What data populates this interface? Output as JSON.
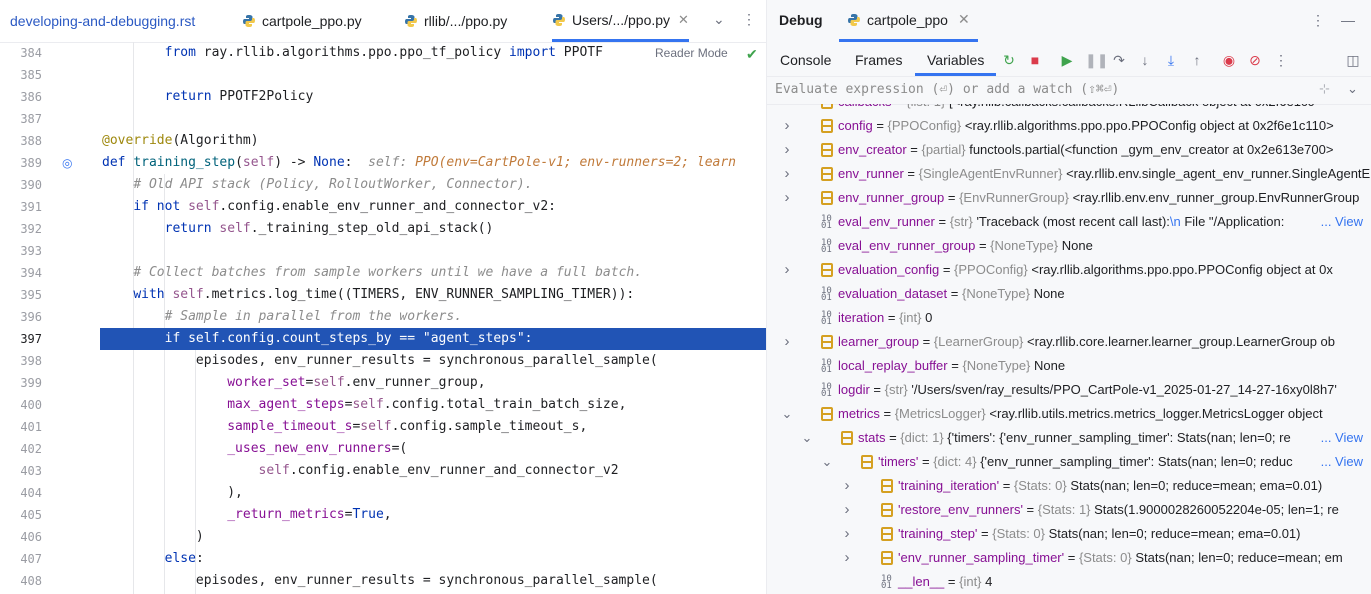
{
  "editor": {
    "tabs": [
      {
        "label": "developing-and-debugging.rst",
        "python": false
      },
      {
        "label": "cartpole_ppo.py",
        "python": true
      },
      {
        "label": "rllib/.../ppo.py",
        "python": true
      },
      {
        "label": "Users/.../ppo.py",
        "python": true,
        "active": true,
        "closable": true
      }
    ],
    "reader_mode": "Reader Mode",
    "current_line": 397,
    "line_numbers": [
      384,
      385,
      386,
      387,
      388,
      389,
      390,
      391,
      392,
      393,
      394,
      395,
      396,
      397,
      398,
      399,
      400,
      401,
      402,
      403,
      404,
      405,
      406,
      407,
      408
    ],
    "lines": [
      [
        {
          "t": "        "
        },
        {
          "t": "from",
          "c": "kw"
        },
        {
          "t": " ray.rllib.algorithms.ppo.ppo_tf_policy "
        },
        {
          "t": "import",
          "c": "kw"
        },
        {
          "t": " PPOTF"
        }
      ],
      [],
      [
        {
          "t": "        "
        },
        {
          "t": "return",
          "c": "kw"
        },
        {
          "t": " PPOTF2Policy"
        }
      ],
      [],
      [
        {
          "t": "@override",
          "c": "dec"
        },
        {
          "t": "(Algorithm)"
        }
      ],
      [
        {
          "t": "def",
          "c": "kw"
        },
        {
          "t": " "
        },
        {
          "t": "training_step",
          "c": "fn"
        },
        {
          "t": "("
        },
        {
          "t": "self",
          "c": "self"
        },
        {
          "t": ") -> "
        },
        {
          "t": "None",
          "c": "kw"
        },
        {
          "t": ":  "
        },
        {
          "t": "self: ",
          "c": "hintlbl"
        },
        {
          "t": "PPO(env=CartPole-v1; env-runners=2; learn",
          "c": "hint"
        }
      ],
      [
        {
          "t": "    "
        },
        {
          "t": "# Old API stack (Policy, RolloutWorker, Connector).",
          "c": "cm"
        }
      ],
      [
        {
          "t": "    "
        },
        {
          "t": "if not",
          "c": "kw"
        },
        {
          "t": " "
        },
        {
          "t": "self",
          "c": "self"
        },
        {
          "t": ".config.enable_env_runner_and_connector_v2:"
        }
      ],
      [
        {
          "t": "        "
        },
        {
          "t": "return",
          "c": "kw"
        },
        {
          "t": " "
        },
        {
          "t": "self",
          "c": "self"
        },
        {
          "t": "._training_step_old_api_stack()"
        }
      ],
      [],
      [
        {
          "t": "    "
        },
        {
          "t": "# Collect batches from sample workers until we have a full batch.",
          "c": "cm"
        }
      ],
      [
        {
          "t": "    "
        },
        {
          "t": "with",
          "c": "kw"
        },
        {
          "t": " "
        },
        {
          "t": "self",
          "c": "self"
        },
        {
          "t": ".metrics.log_time((TIMERS, ENV_RUNNER_SAMPLING_TIMER)):"
        }
      ],
      [
        {
          "t": "        "
        },
        {
          "t": "# Sample in parallel from the workers.",
          "c": "cm"
        }
      ],
      [
        {
          "t": "        "
        },
        {
          "t": "if self.config.count_steps_by == \"agent_steps\":"
        }
      ],
      [
        {
          "t": "            episodes, env_runner_results = synchronous_parallel_sample("
        }
      ],
      [
        {
          "t": "                "
        },
        {
          "t": "worker_set",
          "c": "kwarg"
        },
        {
          "t": "="
        },
        {
          "t": "self",
          "c": "self"
        },
        {
          "t": ".env_runner_group,"
        }
      ],
      [
        {
          "t": "                "
        },
        {
          "t": "max_agent_steps",
          "c": "kwarg"
        },
        {
          "t": "="
        },
        {
          "t": "self",
          "c": "self"
        },
        {
          "t": ".config.total_train_batch_size,"
        }
      ],
      [
        {
          "t": "                "
        },
        {
          "t": "sample_timeout_s",
          "c": "kwarg"
        },
        {
          "t": "="
        },
        {
          "t": "self",
          "c": "self"
        },
        {
          "t": ".config.sample_timeout_s,"
        }
      ],
      [
        {
          "t": "                "
        },
        {
          "t": "_uses_new_env_runners",
          "c": "kwarg"
        },
        {
          "t": "=("
        }
      ],
      [
        {
          "t": "                    "
        },
        {
          "t": "self",
          "c": "self"
        },
        {
          "t": ".config.enable_env_runner_and_connector_v2"
        }
      ],
      [
        {
          "t": "                ),"
        }
      ],
      [
        {
          "t": "                "
        },
        {
          "t": "_return_metrics",
          "c": "kwarg"
        },
        {
          "t": "="
        },
        {
          "t": "True",
          "c": "kw"
        },
        {
          "t": ","
        }
      ],
      [
        {
          "t": "            )"
        }
      ],
      [
        {
          "t": "        "
        },
        {
          "t": "else",
          "c": "kw"
        },
        {
          "t": ":"
        }
      ],
      [
        {
          "t": "            episodes, env_runner_results = synchronous_parallel_sample("
        }
      ]
    ]
  },
  "debug": {
    "title": "Debug",
    "session_tab": "cartpole_ppo",
    "subtabs": [
      "Console",
      "Frames",
      "Variables"
    ],
    "active_subtab": "Variables",
    "eval_placeholder": "Evaluate expression (⏎) or add a watch (⇧⌘⏎)",
    "variables": [
      {
        "depth": 0,
        "expand": "none",
        "icon": "obj",
        "name": "callbacks",
        "type": "{list: 1}",
        "value": "[<ray.rllib.callbacks.callbacks.RLlibCallback object at 0x2f6e1c0",
        "partial": true
      },
      {
        "depth": 0,
        "expand": "closed",
        "icon": "obj",
        "name": "config",
        "type": "{PPOConfig}",
        "value": "<ray.rllib.algorithms.ppo.ppo.PPOConfig object at 0x2f6e1c110>"
      },
      {
        "depth": 0,
        "expand": "closed",
        "icon": "obj",
        "name": "env_creator",
        "type": "{partial}",
        "value": "functools.partial(<function _gym_env_creator at 0x2e613e700>"
      },
      {
        "depth": 0,
        "expand": "closed",
        "icon": "obj",
        "name": "env_runner",
        "type": "{SingleAgentEnvRunner}",
        "value": "<ray.rllib.env.single_agent_env_runner.SingleAgentEnvRunner"
      },
      {
        "depth": 0,
        "expand": "closed",
        "icon": "obj",
        "name": "env_runner_group",
        "type": "{EnvRunnerGroup}",
        "value": "<ray.rllib.env.env_runner_group.EnvRunnerGroup"
      },
      {
        "depth": 0,
        "expand": "none",
        "icon": "prim",
        "name": "eval_env_runner",
        "type": "{str}",
        "value": "'Traceback (most recent call last):",
        "extra": "\\n",
        "tail": " File \"/Application:",
        "view": "... View"
      },
      {
        "depth": 0,
        "expand": "none",
        "icon": "prim",
        "name": "eval_env_runner_group",
        "type": "{NoneType}",
        "value": "None"
      },
      {
        "depth": 0,
        "expand": "closed",
        "icon": "obj",
        "name": "evaluation_config",
        "type": "{PPOConfig}",
        "value": "<ray.rllib.algorithms.ppo.ppo.PPOConfig object at 0x"
      },
      {
        "depth": 0,
        "expand": "none",
        "icon": "prim",
        "name": "evaluation_dataset",
        "type": "{NoneType}",
        "value": "None"
      },
      {
        "depth": 0,
        "expand": "none",
        "icon": "prim",
        "name": "iteration",
        "type": "{int}",
        "value": "0"
      },
      {
        "depth": 0,
        "expand": "closed",
        "icon": "obj",
        "name": "learner_group",
        "type": "{LearnerGroup}",
        "value": "<ray.rllib.core.learner.learner_group.LearnerGroup ob"
      },
      {
        "depth": 0,
        "expand": "none",
        "icon": "prim",
        "name": "local_replay_buffer",
        "type": "{NoneType}",
        "value": "None"
      },
      {
        "depth": 0,
        "expand": "none",
        "icon": "prim",
        "name": "logdir",
        "type": "{str}",
        "value": "'/Users/sven/ray_results/PPO_CartPole-v1_2025-01-27_14-27-16xy0l8h7'"
      },
      {
        "depth": 0,
        "expand": "open",
        "icon": "obj",
        "name": "metrics",
        "type": "{MetricsLogger}",
        "value": "<ray.rllib.utils.metrics.metrics_logger.MetricsLogger object"
      },
      {
        "depth": 1,
        "expand": "open",
        "icon": "obj",
        "name": "stats",
        "type": "{dict: 1}",
        "value": "{'timers': {'env_runner_sampling_timer': Stats(nan; len=0; re",
        "view": "... View"
      },
      {
        "depth": 2,
        "expand": "open",
        "icon": "obj",
        "name": "'timers'",
        "type": "{dict: 4}",
        "value": "{'env_runner_sampling_timer': Stats(nan; len=0; reduc",
        "view": "... View"
      },
      {
        "depth": 3,
        "expand": "closed",
        "icon": "obj",
        "name": "'training_iteration'",
        "type": "{Stats: 0}",
        "value": "Stats(nan; len=0; reduce=mean; ema=0.01)"
      },
      {
        "depth": 3,
        "expand": "closed",
        "icon": "obj",
        "name": "'restore_env_runners'",
        "type": "{Stats: 1}",
        "value": "Stats(1.900002826005​2204e-05; len=1; re"
      },
      {
        "depth": 3,
        "expand": "closed",
        "icon": "obj",
        "name": "'training_step'",
        "type": "{Stats: 0}",
        "value": "Stats(nan; len=0; reduce=mean; ema=0.01)"
      },
      {
        "depth": 3,
        "expand": "closed",
        "icon": "obj",
        "name": "'env_runner_sampling_timer'",
        "type": "{Stats: 0}",
        "value": "Stats(nan; len=0; reduce=mean; em"
      },
      {
        "depth": 3,
        "expand": "none",
        "icon": "prim",
        "name": "__len__",
        "type": "{int}",
        "value": "4"
      }
    ]
  }
}
